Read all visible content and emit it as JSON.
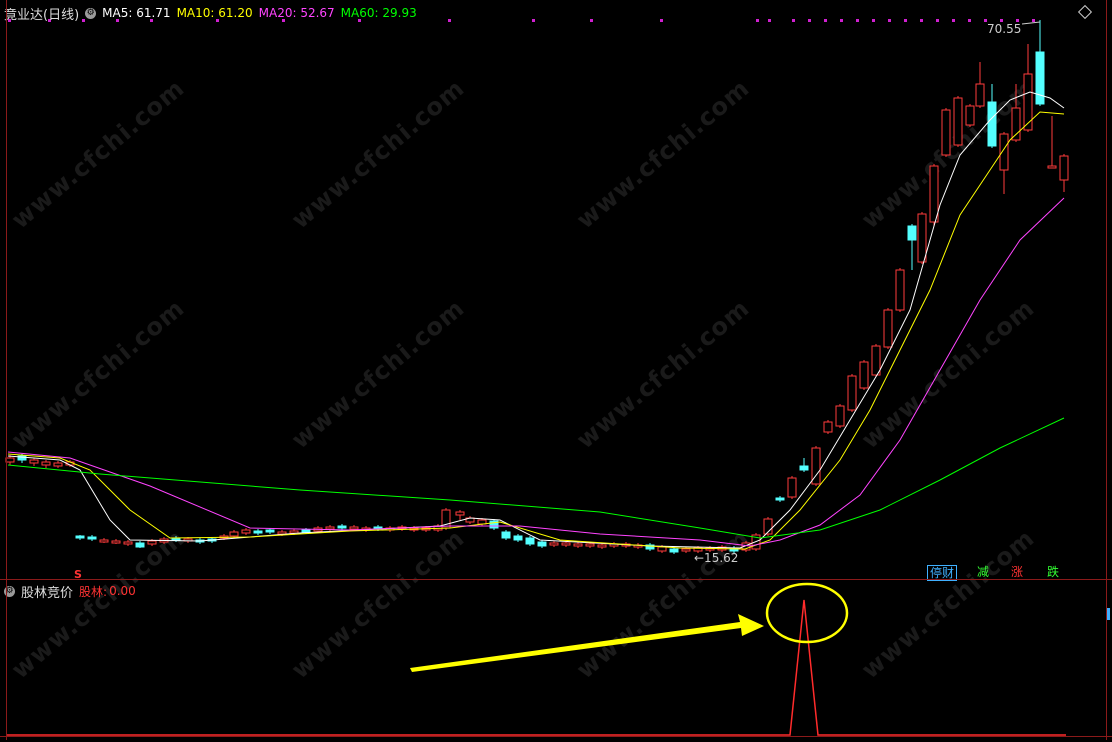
{
  "main_panel": {
    "title": "竟业达(日线)",
    "indicators": [
      {
        "label": "MA5: 61.71",
        "color": "#ffffff"
      },
      {
        "label": "MA10: 61.20",
        "color": "#ffff00"
      },
      {
        "label": "MA20: 52.67",
        "color": "#ff44ff"
      },
      {
        "label": "MA60: 29.93",
        "color": "#00ff00"
      }
    ],
    "high_label": "70.55",
    "low_label": "←15.62",
    "s_marker": "S",
    "tags": [
      {
        "label": "停财",
        "color": "#3fb0ff"
      },
      {
        "label": "减",
        "color": "#33ff33"
      },
      {
        "label": "涨",
        "color": "#ff3333"
      },
      {
        "label": "跌",
        "color": "#33ff33"
      }
    ]
  },
  "sub_panel": {
    "title": "股林竞价",
    "indicator_name": "股林:",
    "indicator_value": "0.00"
  },
  "watermark": "www.cfchi.com",
  "colors": {
    "up": "#ff3b3b",
    "down": "#54ffff",
    "ma5": "#ffffff",
    "ma10": "#ffff00",
    "ma20": "#ff44ff",
    "ma60": "#00ff00",
    "frame": "#8b1a1a",
    "annotation": "#ffff00"
  }
}
